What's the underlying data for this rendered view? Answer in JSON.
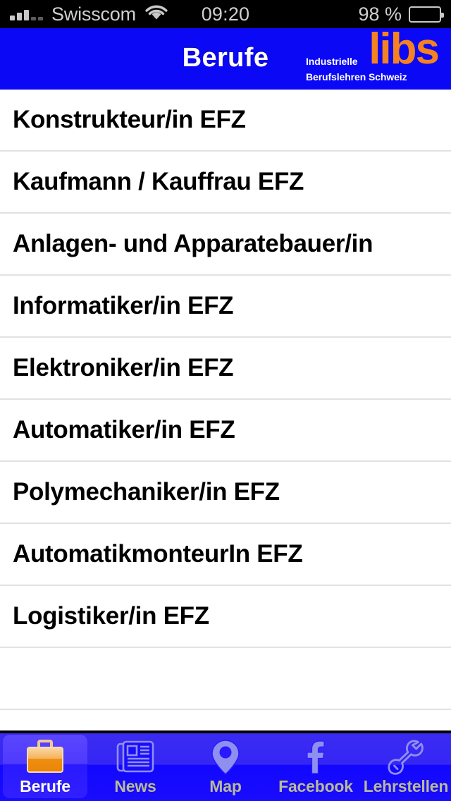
{
  "status_bar": {
    "carrier": "Swisscom",
    "time": "09:20",
    "battery_percent": "98 %",
    "signal_icon": "signal-bars-icon",
    "wifi_icon": "wifi-icon",
    "battery_icon": "battery-icon"
  },
  "nav_bar": {
    "title": "Berufe",
    "logo": {
      "word": "libs",
      "sub_line1": "Industrielle",
      "sub_line2": "Berufslehren Schweiz",
      "word_color": "#f58220"
    },
    "background_color": "#0a08f5"
  },
  "list": {
    "items": [
      {
        "label": "Konstrukteur/in EFZ"
      },
      {
        "label": "Kaufmann / Kauffrau EFZ"
      },
      {
        "label": "Anlagen- und Apparatebauer/in"
      },
      {
        "label": "Informatiker/in EFZ"
      },
      {
        "label": "Elektroniker/in EFZ"
      },
      {
        "label": "Automatiker/in EFZ"
      },
      {
        "label": "Polymechaniker/in EFZ"
      },
      {
        "label": "AutomatikmonteurIn EFZ"
      },
      {
        "label": "Logistiker/in EFZ"
      }
    ],
    "empty_rows": 2,
    "separator_color": "#e2e2e2"
  },
  "tab_bar": {
    "active_index": 0,
    "active_label_color": "#ffffff",
    "inactive_label_color": "#b9b9a0",
    "tabs": [
      {
        "label": "Berufe",
        "icon": "briefcase-icon",
        "active": true
      },
      {
        "label": "News",
        "icon": "newspaper-icon",
        "active": false
      },
      {
        "label": "Map",
        "icon": "map-pin-icon",
        "active": false
      },
      {
        "label": "Facebook",
        "icon": "facebook-icon",
        "active": false
      },
      {
        "label": "Lehrstellen",
        "icon": "wrench-icon",
        "active": false
      }
    ]
  }
}
